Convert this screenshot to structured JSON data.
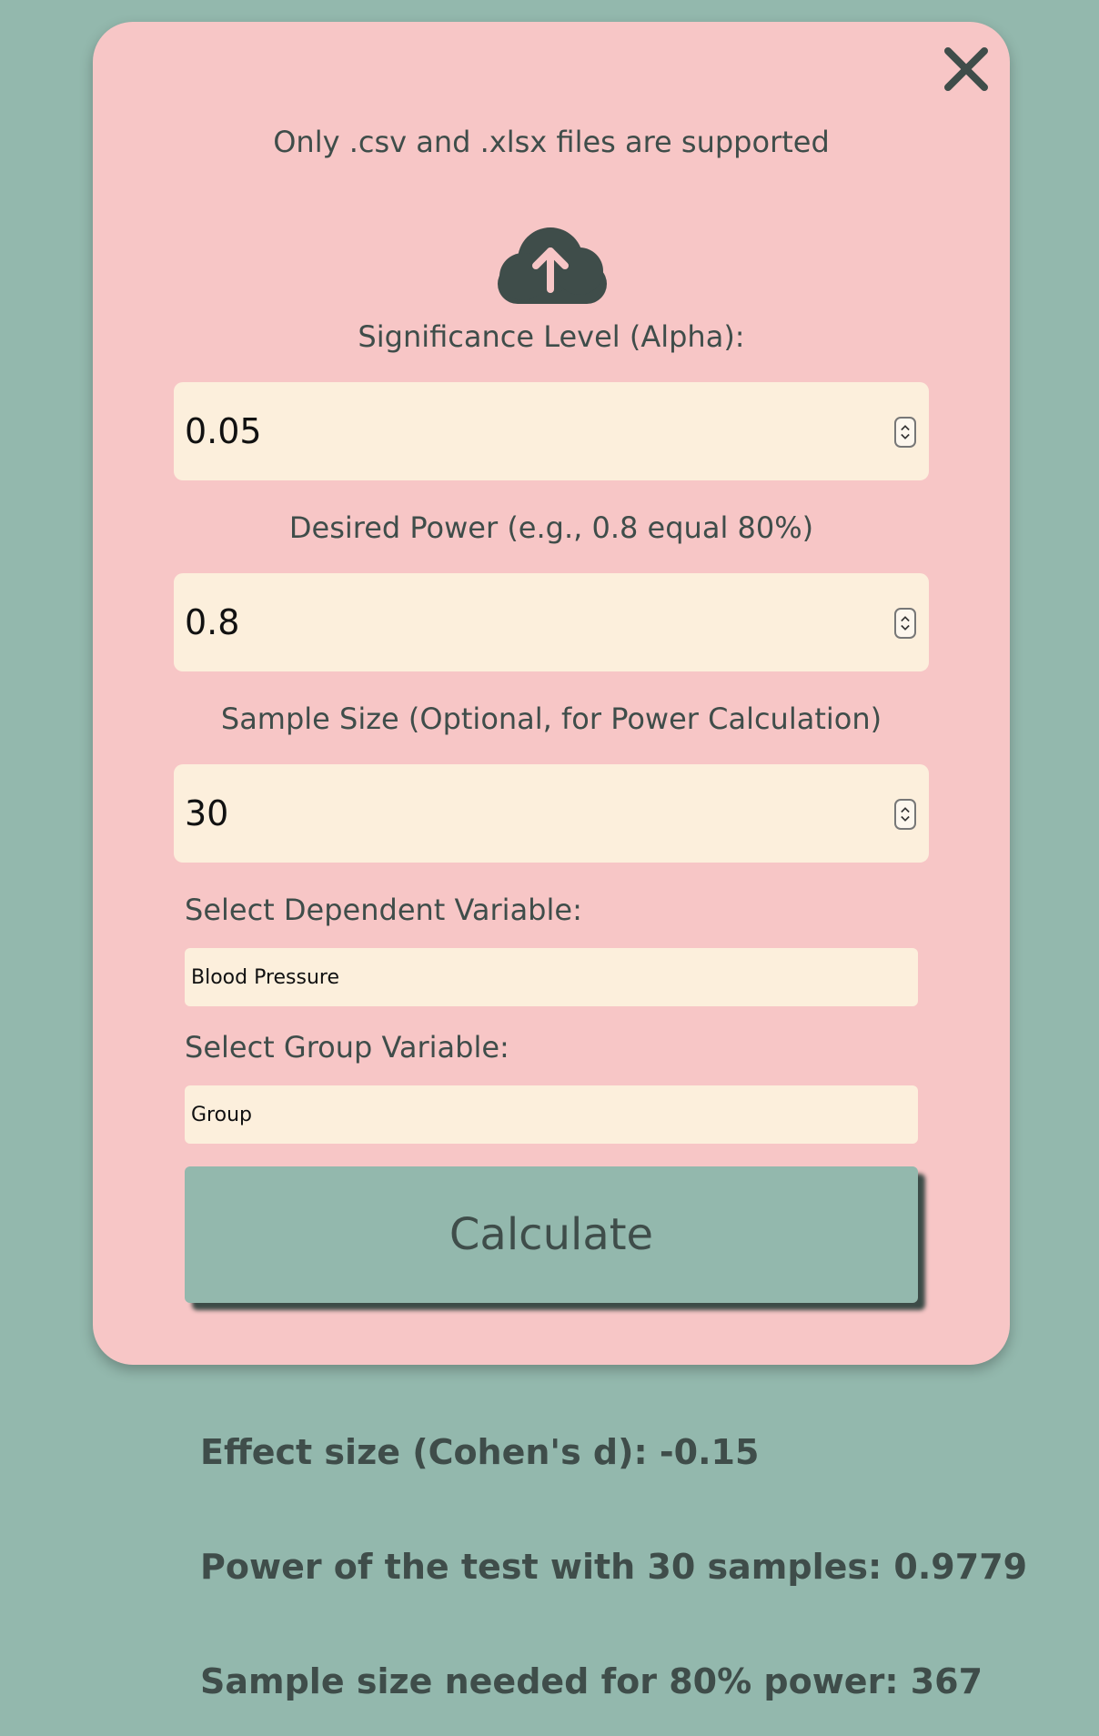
{
  "colors": {
    "background": "#93b8ad",
    "card": "#f7c6c6",
    "input": "#fcefdc",
    "text": "#3f4d4a",
    "button": "#93b8ad"
  },
  "icons": {
    "close": "close-icon",
    "upload": "cloud-upload-icon",
    "spinner": "number-stepper-icon"
  },
  "upload": {
    "notice": "Only .csv and .xlsx files are supported"
  },
  "form": {
    "alpha": {
      "label": "Significance Level (Alpha):",
      "value": "0.05"
    },
    "power": {
      "label": "Desired Power (e.g., 0.8 equal 80%)",
      "value": "0.8"
    },
    "sample_size": {
      "label": "Sample Size (Optional, for Power Calculation)",
      "value": "30"
    },
    "dependent_variable": {
      "label": "Select Dependent Variable:",
      "selected": "Blood Pressure"
    },
    "group_variable": {
      "label": "Select Group Variable:",
      "selected": "Group"
    },
    "calculate_label": "Calculate"
  },
  "results": {
    "effect_size": "Effect size (Cohen's d): -0.15",
    "power": "Power of the test with 30 samples: 0.9779",
    "sample_needed": "Sample size needed for 80% power: 367"
  }
}
